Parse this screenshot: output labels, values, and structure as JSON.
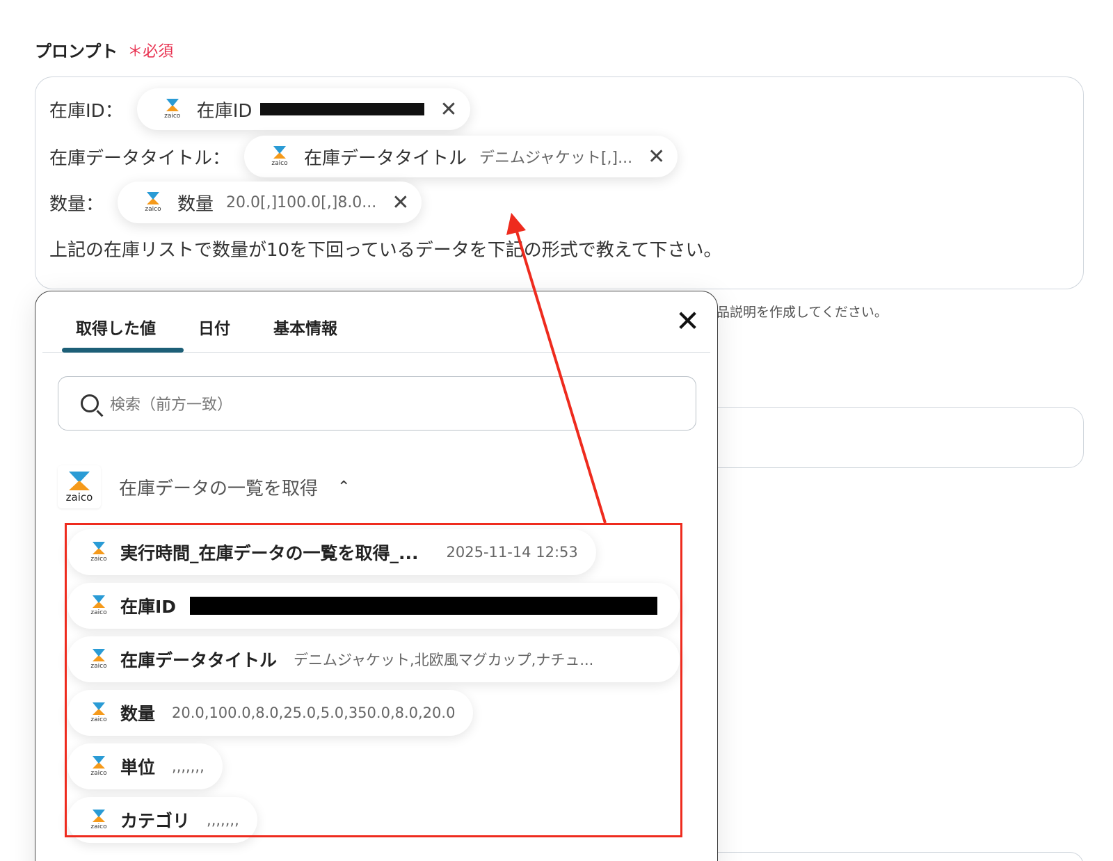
{
  "field": {
    "label": "プロンプト",
    "required": "＊必須"
  },
  "prompt": {
    "rows": [
      {
        "key": "在庫ID：",
        "chip_name": "在庫ID",
        "chip_value": "",
        "close": "✕"
      },
      {
        "key": "在庫データタイトル：",
        "chip_name": "在庫データタイトル",
        "chip_value": "デニムジャケット[,]...",
        "close": "✕"
      },
      {
        "key": "数量：",
        "chip_name": "数量",
        "chip_value": "20.0[,]100.0[,]8.0...",
        "close": "✕"
      }
    ],
    "text": "上記の在庫リストで数量が10を下回っているデータを下記の形式で教えて下さい。"
  },
  "background": {
    "hint": "品説明を作成してください。"
  },
  "panel": {
    "tabs": [
      "取得した値",
      "日付",
      "基本情報"
    ],
    "active_tab": 0,
    "close": "✕",
    "search_placeholder": "検索（前方一致）",
    "group": {
      "logo_text": "zaico",
      "title": "在庫データの一覧を取得",
      "chevron": "⌃"
    },
    "items": [
      {
        "name": "実行時間_在庫データの一覧を取得_...",
        "value": "2025-11-14 12:53"
      },
      {
        "name": "在庫ID",
        "value": ""
      },
      {
        "name": "在庫データタイトル",
        "value": "デニムジャケット,北欧風マグカップ,ナチュ..."
      },
      {
        "name": "数量",
        "value": "20.0,100.0,8.0,25.0,5.0,350.0,8.0,20.0"
      },
      {
        "name": "単位",
        "value": ",,,,,,,"
      },
      {
        "name": "カテゴリ",
        "value": ",,,,,,,"
      }
    ]
  },
  "logo_small_text": "zaico",
  "colors": {
    "required": "#e8304f",
    "tab_active": "#1d5f77",
    "annotation": "#ee2b1e",
    "zaico_blue": "#2a9bd5",
    "zaico_orange": "#f59a1b"
  }
}
